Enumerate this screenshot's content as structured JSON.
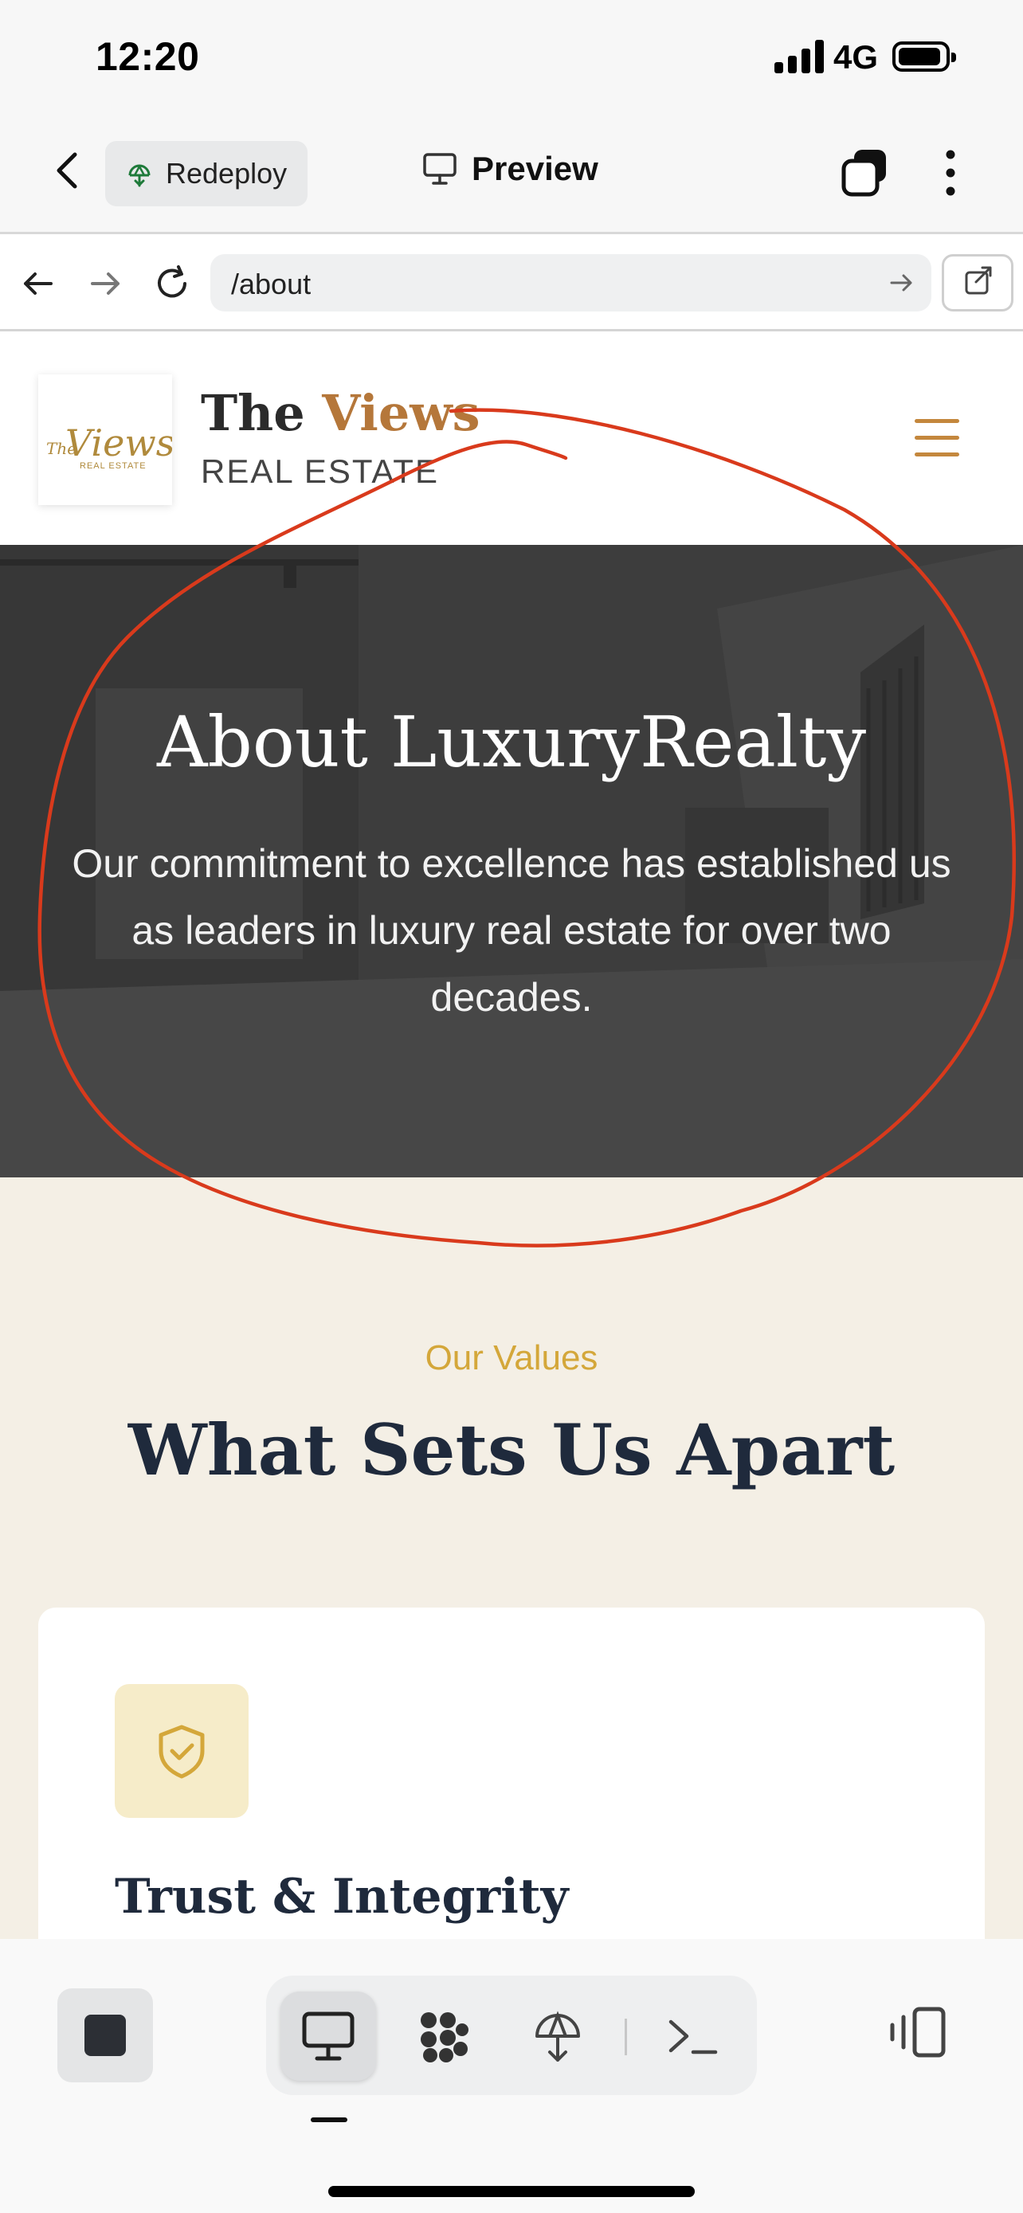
{
  "status_bar": {
    "time": "12:20",
    "network": "4G"
  },
  "app_toolbar": {
    "redeploy_label": "Redeploy",
    "preview_label": "Preview"
  },
  "url_bar": {
    "url": "/about"
  },
  "site_header": {
    "brand_main": "The",
    "brand_accent": "Views",
    "brand_sub": "REAL ESTATE",
    "logo_text": "The Views",
    "logo_sub": "REAL ESTATE"
  },
  "hero": {
    "title": "About LuxuryRealty",
    "text": "Our commitment to excellence has established us as leaders in luxury real estate for over two decades."
  },
  "values": {
    "eyebrow": "Our Values",
    "heading": "What Sets Us Apart",
    "cards": [
      {
        "title": "Trust & Integrity",
        "icon": "shield-check-icon"
      }
    ]
  },
  "colors": {
    "accent": "#b5773a",
    "gold": "#d4a73a",
    "navy": "#1f2a3c",
    "annotation": "#d93a1c"
  },
  "bottom_bar": {
    "icons": [
      "stop-icon",
      "desktop-icon",
      "integrations-icon",
      "deploy-icon",
      "terminal-icon",
      "panel-toggle-icon"
    ]
  }
}
